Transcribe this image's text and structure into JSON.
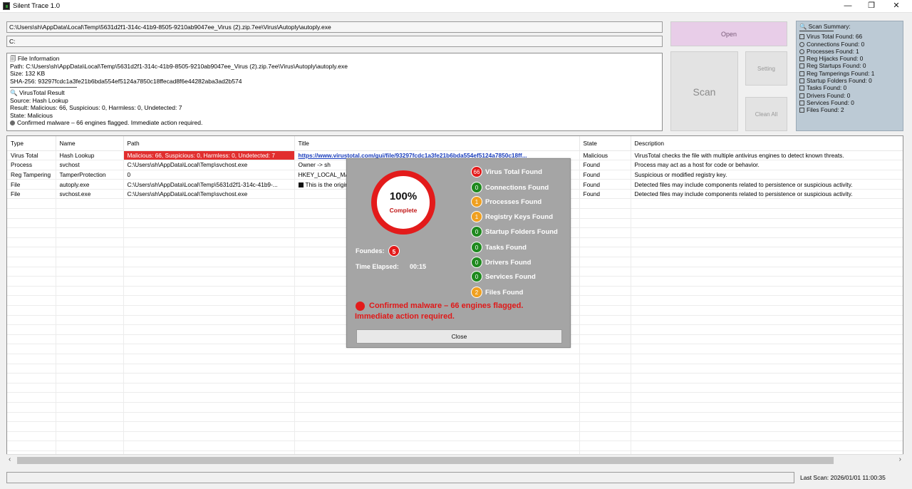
{
  "window": {
    "title": "Silent Trace 1.0",
    "min_glyph": "—",
    "max_glyph": "❐",
    "close_glyph": "✕"
  },
  "inputs": {
    "file_path": "C:\\Users\\sh\\AppData\\Local\\Temp\\5631d2f1-314c-41b9-8505-9210ab9047ee_Virus (2).zip.7ee\\Virus\\Autoply\\autoply.exe",
    "drive": "C:"
  },
  "file_info": {
    "header": "🗐 File Information",
    "path": "Path: C:\\Users\\sh\\AppData\\Local\\Temp\\5631d2f1-314c-41b9-8505-9210ab9047ee_Virus (2).zip.7ee\\Virus\\Autoply\\autoply.exe",
    "size": "Size: 132 KB",
    "sha": "SHA-256: 93297fcdc1a3fe21b6bda554ef5124a7850c18ffecad8f6e44282aba3ad2b574"
  },
  "vt_result": {
    "header": "🔍 VirusTotal Result",
    "source": "Source: Hash Lookup",
    "result": "Result: Malicious: 66, Suspicious: 0, Harmless: 0, Undetected: 7",
    "state": "State: Malicious",
    "verdict": "Confirmed malware – 66 engines flagged. Immediate action required."
  },
  "buttons": {
    "open": "Open",
    "scan": "Scan",
    "setting": "Setting",
    "clean_all": "Clean All"
  },
  "summary": {
    "title": "🔍 Scan Summary:",
    "items": [
      "Virus Total Found: 66",
      "Connections Found: 0",
      "Processes Found: 1",
      "Reg Hijacks Found: 0",
      "Reg Startups Found: 0",
      "Reg Tamperings Found: 1",
      "Startup Folders Found: 0",
      "Tasks Found: 0",
      "Drivers Found: 0",
      "Services Found: 0",
      "Files Found: 2"
    ]
  },
  "table": {
    "columns": [
      "Type",
      "Name",
      "Path",
      "Title",
      "State",
      "Description"
    ],
    "rows": [
      [
        "Virus Total",
        "Hash Lookup",
        "Malicious: 66, Suspicious: 0, Harmless: 0, Undetected: 7",
        "https://www.virustotal.com/gui/file/93297fcdc1a3fe21b6bda554ef5124a7850c18ff...",
        "Malicious",
        "VirusTotal checks the file with multiple antivirus engines to detect known threats."
      ],
      [
        "Process",
        "svchost",
        "C:\\Users\\sh\\AppData\\Local\\Temp\\svchost.exe",
        "Owner -> sh",
        "Found",
        "Process may act as a host for code or behavior."
      ],
      [
        "Reg Tampering",
        "TamperProtection",
        "0",
        "HKEY_LOCAL_MACHINE\\SOFTWARE\\Microsoft\\Windows Defender\\Features",
        "Found",
        "Suspicious or modified registry key."
      ],
      [
        "File",
        "autoply.exe",
        "C:\\Users\\sh\\AppData\\Local\\Temp\\5631d2f1-314c-41b9-...",
        "This is the original file",
        "Found",
        "Detected files may include components related to persistence or suspicious activity."
      ],
      [
        "File",
        "svchost.exe",
        "C:\\Users\\sh\\AppData\\Local\\Temp\\svchost.exe",
        "",
        "Found",
        "Detected files may include components related to persistence or suspicious activity."
      ]
    ]
  },
  "dialog": {
    "percent": "100%",
    "complete": "Complete",
    "progress_fraction": 1.0,
    "founds_label": "Foundes:",
    "founds_count": "5",
    "time_label": "Time Elapsed:",
    "time_value": "00:15",
    "stats": [
      {
        "count": "66",
        "label": "Virus Total Found",
        "color": "#e31b1b"
      },
      {
        "count": "0",
        "label": "Connections Found",
        "color": "#1f8a1f"
      },
      {
        "count": "1",
        "label": "Processes Found",
        "color": "#f0a020"
      },
      {
        "count": "1",
        "label": "Registry Keys Found",
        "color": "#f0a020"
      },
      {
        "count": "0",
        "label": "Startup Folders Found",
        "color": "#1f8a1f"
      },
      {
        "count": "0",
        "label": "Tasks Found",
        "color": "#1f8a1f"
      },
      {
        "count": "0",
        "label": "Drivers Found",
        "color": "#1f8a1f"
      },
      {
        "count": "0",
        "label": "Services Found",
        "color": "#1f8a1f"
      },
      {
        "count": "2",
        "label": "Files Found",
        "color": "#f0a020"
      }
    ],
    "alert": "Confirmed malware – 66 engines flagged. Immediate action required.",
    "close": "Close"
  },
  "status": {
    "last_scan": "Last Scan:   2026/01/01 11:00:35"
  }
}
